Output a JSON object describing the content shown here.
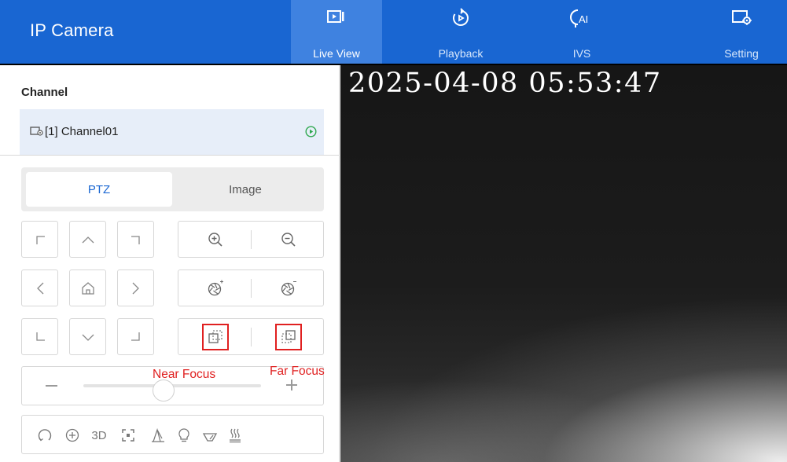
{
  "header": {
    "title": "IP Camera",
    "tabs": [
      {
        "label": "Live View",
        "icon": "live-view-icon",
        "active": true
      },
      {
        "label": "Playback",
        "icon": "playback-icon",
        "active": false
      },
      {
        "label": "IVS",
        "icon": "ivs-icon",
        "active": false
      },
      {
        "label": "Setting",
        "icon": "setting-icon",
        "active": false
      }
    ]
  },
  "sidebar": {
    "channel_title": "Channel",
    "channel": {
      "name": "[1] Channel01",
      "icon": "camera-icon",
      "status_icon": "play-circle-icon"
    },
    "segments": {
      "ptz": "PTZ",
      "image": "Image",
      "active": "PTZ"
    },
    "ptz": {
      "directions": [
        "up-left",
        "up",
        "up-right",
        "left",
        "home",
        "right",
        "down-left",
        "down",
        "down-right"
      ],
      "zoom": [
        "zoom-in-icon",
        "zoom-out-icon"
      ],
      "iris": [
        "iris-open-icon",
        "iris-close-icon"
      ],
      "focus": [
        "near-focus-icon",
        "far-focus-icon"
      ],
      "annotations": {
        "near_focus": "Near Focus",
        "far_focus": "Far Focus"
      },
      "speed_slider": {
        "level": 0.45
      },
      "toolbar": {
        "tool_3d_label": "3D",
        "icons": [
          "scan-icon",
          "crosshair-icon",
          "3d-icon",
          "center-icon",
          "wiper-icon",
          "light-icon",
          "speed-icon",
          "heater-icon"
        ]
      }
    }
  },
  "video": {
    "timestamp": "2025-04-08 05:53:47"
  },
  "colors": {
    "brand": "#1966d2",
    "tab_active": "#3f82e0",
    "channel_row": "#e7eef9",
    "accent_text": "#1966d2",
    "annotation": "#e02020"
  }
}
